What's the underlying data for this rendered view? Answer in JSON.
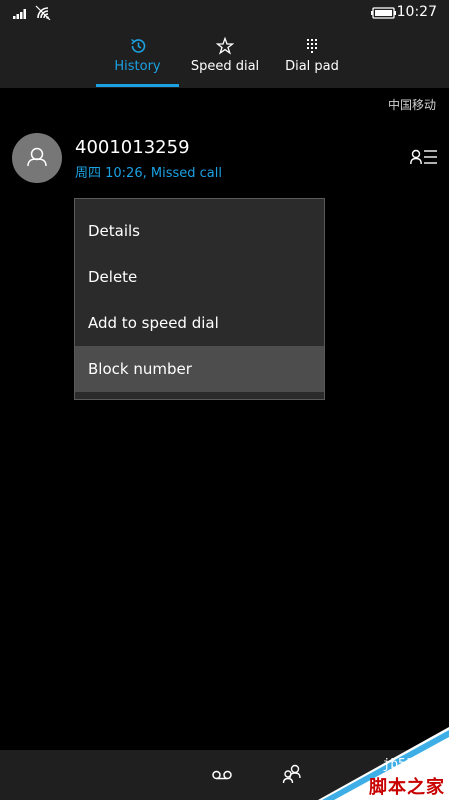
{
  "status_bar": {
    "time": "10:27"
  },
  "pivot": {
    "tabs": [
      {
        "label": "History",
        "icon": "history-icon",
        "active": true
      },
      {
        "label": "Speed dial",
        "icon": "star-icon",
        "active": false
      },
      {
        "label": "Dial pad",
        "icon": "dialpad-icon",
        "active": false
      }
    ]
  },
  "carrier": "中国移动",
  "call_entry": {
    "number": "4001013259",
    "detail": "周四 10:26, Missed call"
  },
  "context_menu": {
    "items": [
      {
        "label": "Details"
      },
      {
        "label": "Delete"
      },
      {
        "label": "Add to speed dial"
      },
      {
        "label": "Block number",
        "highlighted": true
      }
    ]
  },
  "app_bar": {
    "buttons": [
      "voicemail-icon",
      "contacts-icon"
    ]
  },
  "watermark": {
    "site": "jb51.net",
    "name": "脚本之家"
  },
  "colors": {
    "accent": "#1ba1e2",
    "background": "#000000",
    "chrome": "#1f1f1f",
    "menu_bg": "#2b2b2b",
    "menu_highlight": "#4d4d4d",
    "avatar": "#777777",
    "watermark_red": "#c80000"
  }
}
